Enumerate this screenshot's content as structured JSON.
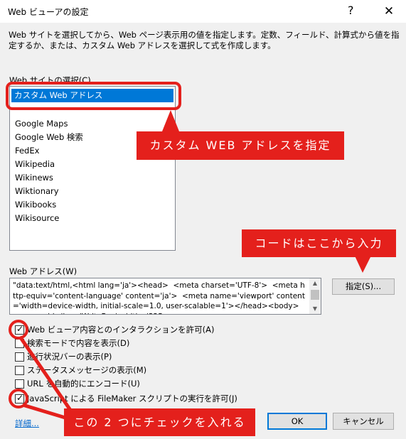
{
  "window": {
    "title": "Web ビューアの設定",
    "help_glyph": "?",
    "close_glyph": "✕"
  },
  "description": "Web サイトを選択してから、Web ページ表示用の値を指定します。定数、フィールド、計算式から値を指定するか、または、カスタム Web アドレスを選択して式を作成します。",
  "site_section": {
    "label": "Web サイトの選択(C)",
    "selected": "カスタム Web アドレス",
    "items": [
      "Google Maps",
      "Google Web 検索",
      "FedEx",
      "Wikipedia",
      "Wikinews",
      "Wiktionary",
      "Wikibooks",
      "Wikisource"
    ]
  },
  "url_section": {
    "label": "Web アドレス(W)",
    "value": "\"data:text/html,<html lang='ja'><head>  <meta charset='UTF-8'>  <meta http-equiv='content-language' content='ja'>  <meta name='viewport' content='width=device-width, initial-scale=1.0, user-scalable=1'></head><body>   <canvas id='handWriteBox' width='325",
    "specify_button": "指定(S)..."
  },
  "options": [
    {
      "label": "Web ビューア内容とのインタラクションを許可(A)",
      "checked": true
    },
    {
      "label": "検索モードで内容を表示(D)",
      "checked": false
    },
    {
      "label": "進行状況バーの表示(P)",
      "checked": false
    },
    {
      "label": "ステータスメッセージの表示(M)",
      "checked": false
    },
    {
      "label": "URL を自動的にエンコード(U)",
      "checked": false
    },
    {
      "label": "JavaScript による FileMaker スクリプトの実行を許可(J)",
      "checked": true
    }
  ],
  "checkmark": "✓",
  "footer": {
    "details_link": "詳細...",
    "ok_button": "OK",
    "cancel_button": "キャンセル"
  },
  "annotations": {
    "custom_url": "カスタム WEB アドレスを指定",
    "code_input": "コードはここから入力",
    "check_these": "この 2 つにチェックを入れる"
  },
  "colors": {
    "annotation_red": "#e4201c",
    "selection_blue": "#0078d7",
    "link_blue": "#0066cc"
  }
}
